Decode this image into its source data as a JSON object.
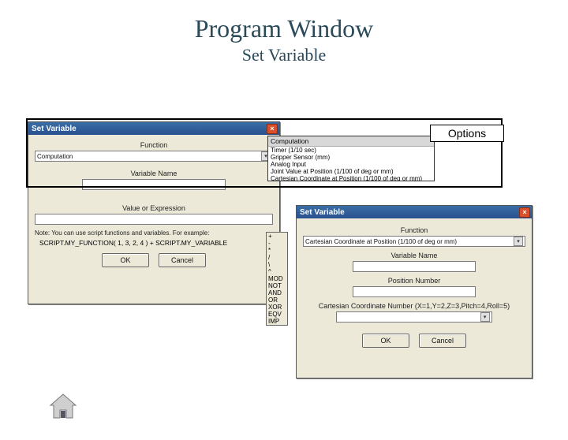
{
  "page": {
    "title": "Program Window",
    "subtitle": "Set Variable",
    "options_label": "Options"
  },
  "dlg1": {
    "title": "Set Variable",
    "function_label": "Function",
    "function_value": "Computation",
    "varname_label": "Variable Name",
    "value_label": "Value or Expression",
    "note": "Note: You can use script functions and variables. For example:",
    "example": "SCRIPT.MY_FUNCTION( 1, 3, 2, 4 ) + SCRIPT.MY_VARIABLE",
    "ok": "OK",
    "cancel": "Cancel"
  },
  "computation_list": {
    "header": "Computation",
    "items": [
      "Timer (1/10 sec)",
      "Gripper Sensor (mm)",
      "Analog Input",
      "Joint Value at Position (1/100 of deg or mm)",
      "Cartesian Coordinate at Position (1/100 of deg or mm)"
    ]
  },
  "operators": [
    "+",
    "-",
    "*",
    "/",
    "\\",
    "^",
    "MOD",
    "NOT",
    "AND",
    "OR",
    "XOR",
    "EQV",
    "IMP"
  ],
  "dlg2": {
    "title": "Set Variable",
    "function_label": "Function",
    "function_value": "Cartesian Coordinate at Position (1/100 of deg or mm)",
    "varname_label": "Variable Name",
    "posnum_label": "Position Number",
    "cartnum_label": "Cartesian Coordinate Number (X=1,Y=2,Z=3,Pitch=4,Roll=5)",
    "ok": "OK",
    "cancel": "Cancel"
  }
}
